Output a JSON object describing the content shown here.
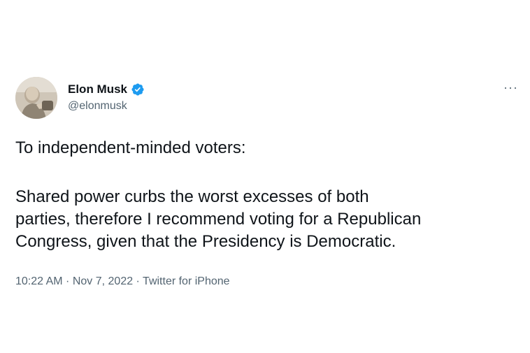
{
  "author": {
    "display_name": "Elon Musk",
    "handle": "@elonmusk",
    "verified_icon": "verified-badge-icon",
    "verified_color": "#1d9bf0"
  },
  "menu": {
    "more_icon": "more-dots-icon",
    "more_label": "···"
  },
  "tweet": {
    "line1": "To independent-minded voters:",
    "paragraph2_line1": "Shared power curbs the worst excesses of both",
    "paragraph2_line2": "parties, therefore I recommend voting for a Republican",
    "paragraph2_line3": "Congress, given that the Presidency is Democratic."
  },
  "meta": {
    "time": "10:22 AM",
    "separator": " · ",
    "date": "Nov 7, 2022",
    "source": "Twitter for iPhone"
  }
}
